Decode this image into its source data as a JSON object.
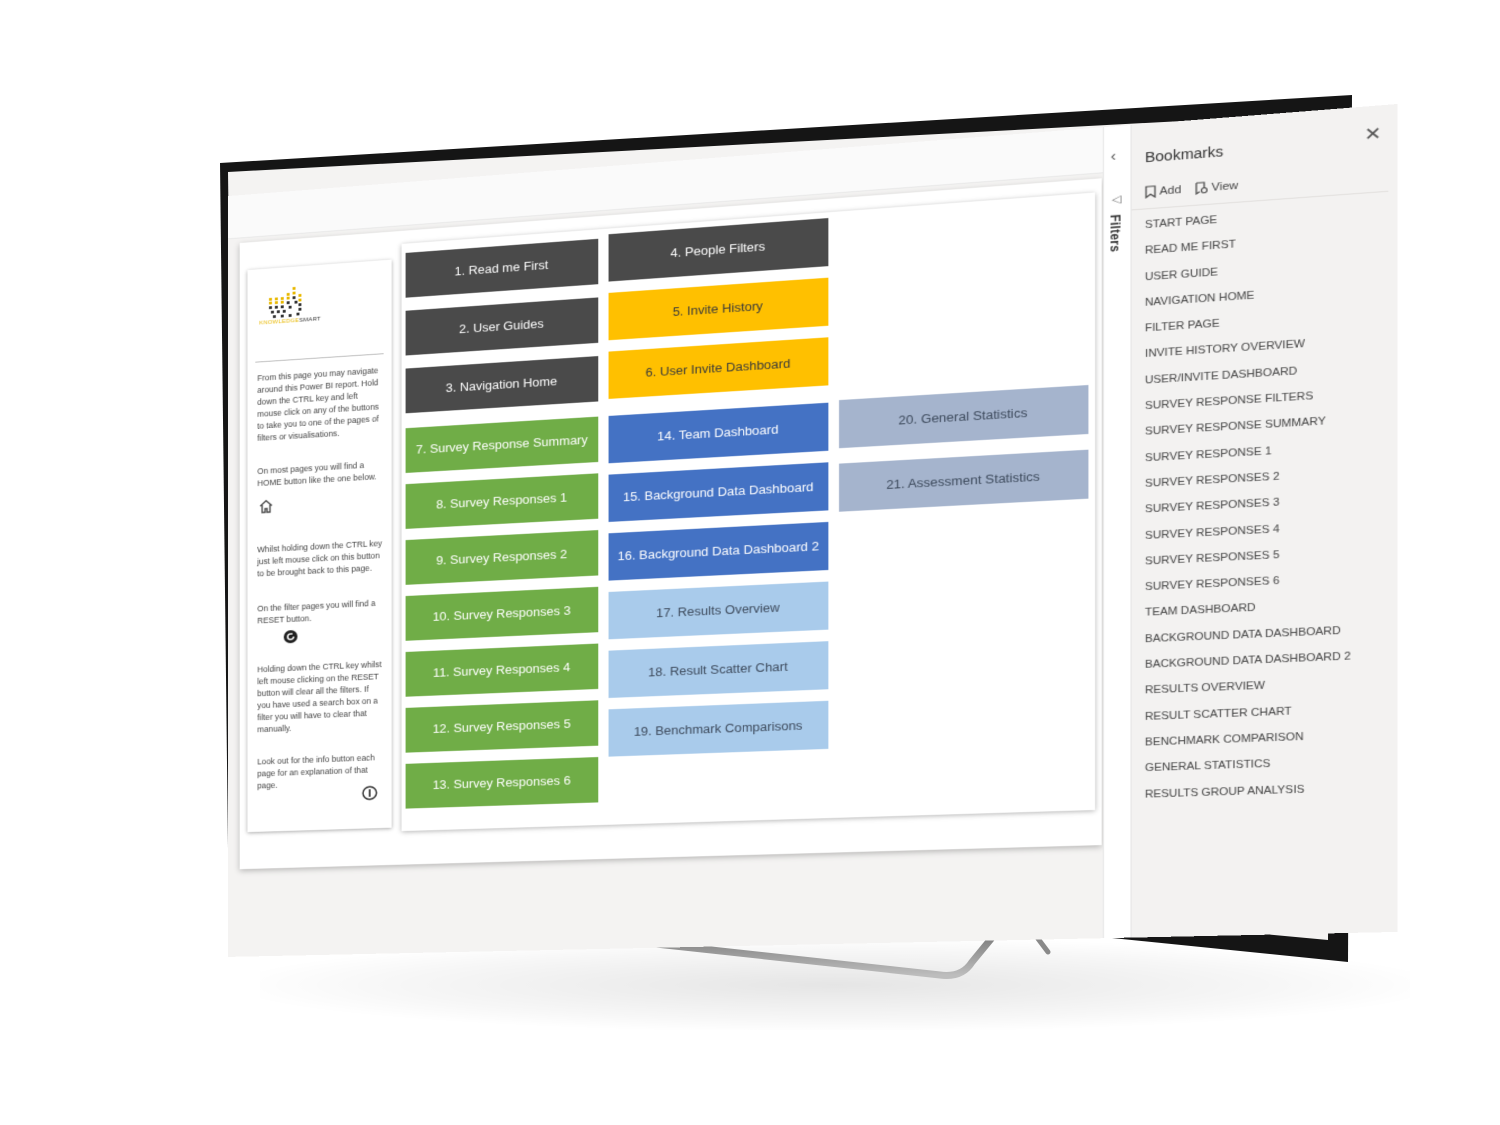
{
  "colors": {
    "dark": "#4a4a4a",
    "yellow": "#ffc000",
    "green": "#70ad47",
    "blue": "#4472c4",
    "light_blue": "#a9cbeb",
    "grey_blue": "#a5b4cd"
  },
  "info_card": {
    "logo": {
      "part1": "KNOWLEDGE",
      "part2": "SMART"
    },
    "paragraphs": [
      "From this page you may navigate around this Power BI report.  Hold down the CTRL key and left mouse click on any of the  buttons to take you to one of the pages of filters or visualisations.",
      "On most pages you will find a HOME button like the one below.",
      "Whilst holding down the CTRL key just left mouse click on this button to be brought back to this page.",
      "On the filter pages you will find a RESET button.",
      "Holding down the CTRL key whilst left mouse clicking on the RESET button will clear all the filters.  If you have used a search box on a filter you will have to clear that manually.",
      "Look out for the info button each page for an explanation of that page."
    ],
    "icons": {
      "home": "home-icon",
      "reset": "reset-icon",
      "info": "info-icon"
    }
  },
  "nav_buttons": [
    {
      "label": "1. Read me First",
      "color": "dark"
    },
    {
      "label": "2. User Guides",
      "color": "dark"
    },
    {
      "label": "3. Navigation Home",
      "color": "dark"
    },
    {
      "label": "4. People Filters",
      "color": "dark"
    },
    {
      "label": "5. Invite History",
      "color": "yellow"
    },
    {
      "label": "6. User Invite Dashboard",
      "color": "yellow"
    },
    {
      "label": "7. Survey Response Summary",
      "color": "green"
    },
    {
      "label": "8. Survey Responses 1",
      "color": "green"
    },
    {
      "label": "9. Survey Responses 2",
      "color": "green"
    },
    {
      "label": "10. Survey Responses 3",
      "color": "green"
    },
    {
      "label": "11. Survey Responses 4",
      "color": "green"
    },
    {
      "label": "12. Survey Responses 5",
      "color": "green"
    },
    {
      "label": "13. Survey Responses 6",
      "color": "green"
    },
    {
      "label": "14. Team Dashboard",
      "color": "blue"
    },
    {
      "label": "15. Background Data Dashboard",
      "color": "blue"
    },
    {
      "label": "16. Background Data Dashboard 2",
      "color": "blue"
    },
    {
      "label": "17. Results Overview",
      "color": "light_blue"
    },
    {
      "label": "18. Result Scatter Chart",
      "color": "light_blue"
    },
    {
      "label": "19. Benchmark Comparisons",
      "color": "light_blue"
    },
    {
      "label": "20. General Statistics",
      "color": "grey_blue"
    },
    {
      "label": "21. Assessment Statistics",
      "color": "grey_blue"
    }
  ],
  "filters_pane": {
    "label": "Filters",
    "collapse_icon": "chevron-left-icon",
    "funnel_icon": "filter-icon"
  },
  "bookmarks": {
    "title": "Bookmarks",
    "add_label": "Add",
    "view_label": "View",
    "items": [
      "START PAGE",
      "READ ME FIRST",
      "USER GUIDE",
      "NAVIGATION HOME",
      "FILTER PAGE",
      "INVITE HISTORY OVERVIEW",
      "USER/INVITE DASHBOARD",
      "SURVEY RESPONSE FILTERS",
      "SURVEY RESPONSE SUMMARY",
      "SURVEY RESPONSE 1",
      "SURVEY RESPONSES 2",
      "SURVEY RESPONSES 3",
      "SURVEY RESPONSES 4",
      "SURVEY RESPONSES 5",
      "SURVEY RESPONSES 6",
      "TEAM DASHBOARD",
      "BACKGROUND DATA DASHBOARD",
      "BACKGROUND DATA DASHBOARD 2",
      "RESULTS OVERVIEW",
      "RESULT SCATTER CHART",
      "BENCHMARK COMPARISON",
      "GENERAL STATISTICS",
      "RESULTS GROUP ANALYSIS"
    ]
  }
}
